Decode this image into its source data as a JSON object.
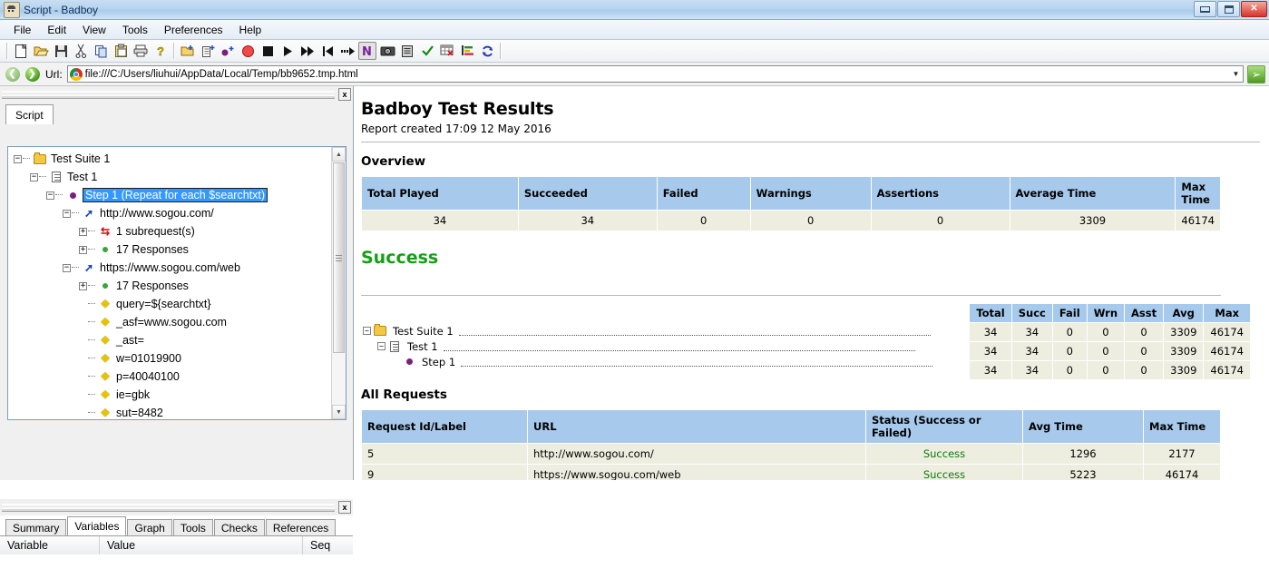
{
  "window": {
    "title": "Script - Badboy",
    "icon": "badboy-app-icon",
    "buttons": {
      "minimize": "minimize",
      "maximize": "maximize",
      "close": "close"
    }
  },
  "menu": {
    "items": [
      "File",
      "Edit",
      "View",
      "Tools",
      "Preferences",
      "Help"
    ]
  },
  "toolbar": {
    "items": [
      {
        "name": "new-icon",
        "glyph": "new"
      },
      {
        "name": "open-folder-icon",
        "glyph": "open"
      },
      {
        "name": "save-icon",
        "glyph": "save"
      },
      {
        "name": "cut-icon",
        "glyph": "cut"
      },
      {
        "name": "copy-icon",
        "glyph": "copy"
      },
      {
        "name": "paste-icon",
        "glyph": "paste"
      },
      {
        "name": "print-icon",
        "glyph": "print"
      },
      {
        "name": "help-icon",
        "glyph": "help"
      },
      {
        "name": "new-suite-icon",
        "glyph": "newsuite"
      },
      {
        "name": "new-test-icon",
        "glyph": "newtest"
      },
      {
        "name": "new-step-icon",
        "glyph": "newstep"
      },
      {
        "name": "record-icon",
        "glyph": "record"
      },
      {
        "name": "stop-icon",
        "glyph": "stop"
      },
      {
        "name": "play-icon",
        "glyph": "play"
      },
      {
        "name": "play-fast-icon",
        "glyph": "playfast"
      },
      {
        "name": "rewind-icon",
        "glyph": "rewind"
      },
      {
        "name": "step-icon",
        "glyph": "stepinto"
      },
      {
        "name": "navigator-icon",
        "glyph": "navigator"
      },
      {
        "name": "screenshot-icon",
        "glyph": "camera"
      },
      {
        "name": "report-icon",
        "glyph": "report"
      },
      {
        "name": "check-icon",
        "glyph": "check"
      },
      {
        "name": "grid-clear-icon",
        "glyph": "gridx"
      },
      {
        "name": "summary-icon",
        "glyph": "summary"
      },
      {
        "name": "refresh-icon",
        "glyph": "refresh"
      }
    ]
  },
  "urlbar": {
    "back_label": "back",
    "forward_label": "forward",
    "label": "Url:",
    "value": "file:///C:/Users/liuhui/AppData/Local/Temp/bb9652.tmp.html",
    "go_label": "go"
  },
  "left_panel": {
    "close_label": "x",
    "tab": "Script",
    "tree": [
      {
        "indent": 0,
        "toggle": "-",
        "icon": "folder-icon",
        "label": "Test Suite 1",
        "selected": false
      },
      {
        "indent": 1,
        "toggle": "-",
        "icon": "test-doc-icon",
        "label": "Test 1",
        "selected": false
      },
      {
        "indent": 2,
        "toggle": "-",
        "icon": "step-bullet-icon",
        "label": "Step 1 (Repeat for each $searchtxt)",
        "selected": true
      },
      {
        "indent": 3,
        "toggle": "-",
        "icon": "request-arrow-icon",
        "label": "http://www.sogou.com/",
        "selected": false
      },
      {
        "indent": 4,
        "toggle": "+",
        "icon": "subrequest-icon",
        "label": "1 subrequest(s)",
        "selected": false
      },
      {
        "indent": 4,
        "toggle": "+",
        "icon": "response-dot-icon",
        "label": "17 Responses",
        "selected": false
      },
      {
        "indent": 3,
        "toggle": "-",
        "icon": "request-arrow-icon",
        "label": "https://www.sogou.com/web",
        "selected": false
      },
      {
        "indent": 4,
        "toggle": "+",
        "icon": "response-dot-icon",
        "label": "17 Responses",
        "selected": false
      },
      {
        "indent": 4,
        "toggle": "",
        "icon": "parameter-key-icon",
        "label": "query=${searchtxt}",
        "selected": false
      },
      {
        "indent": 4,
        "toggle": "",
        "icon": "parameter-key-icon",
        "label": "_asf=www.sogou.com",
        "selected": false
      },
      {
        "indent": 4,
        "toggle": "",
        "icon": "parameter-key-icon",
        "label": "_ast=",
        "selected": false
      },
      {
        "indent": 4,
        "toggle": "",
        "icon": "parameter-key-icon",
        "label": "w=01019900",
        "selected": false
      },
      {
        "indent": 4,
        "toggle": "",
        "icon": "parameter-key-icon",
        "label": "p=40040100",
        "selected": false
      },
      {
        "indent": 4,
        "toggle": "",
        "icon": "parameter-key-icon",
        "label": "ie=gbk",
        "selected": false
      },
      {
        "indent": 4,
        "toggle": "",
        "icon": "parameter-key-icon",
        "label": "sut=8482",
        "selected": false
      }
    ]
  },
  "bottom_panel": {
    "close_label": "x",
    "tabs": [
      "Summary",
      "Variables",
      "Graph",
      "Tools",
      "Checks",
      "References"
    ],
    "active_tab": "Variables",
    "columns": [
      "Variable",
      "Value",
      "Seq"
    ]
  },
  "report": {
    "title": "Badboy Test Results",
    "created": "Report created 17:09 12 May 2016",
    "overview": {
      "heading": "Overview",
      "columns": [
        "Total Played",
        "Succeeded",
        "Failed",
        "Warnings",
        "Assertions",
        "Average Time",
        "Max Time"
      ],
      "row": [
        "34",
        "34",
        "0",
        "0",
        "0",
        "3309",
        "46174"
      ]
    },
    "success": {
      "heading": "Success",
      "columns": [
        "Total",
        "Succ",
        "Fail",
        "Wrn",
        "Asst",
        "Avg",
        "Max"
      ],
      "rows": [
        {
          "indent": 0,
          "toggle": "-",
          "icon": "folder-icon",
          "label": "Test Suite 1",
          "values": [
            "34",
            "34",
            "0",
            "0",
            "0",
            "3309",
            "46174"
          ]
        },
        {
          "indent": 1,
          "toggle": "-",
          "icon": "test-doc-icon",
          "label": "Test 1",
          "values": [
            "34",
            "34",
            "0",
            "0",
            "0",
            "3309",
            "46174"
          ]
        },
        {
          "indent": 2,
          "toggle": "",
          "icon": "step-bullet-icon",
          "label": "Step 1",
          "values": [
            "34",
            "34",
            "0",
            "0",
            "0",
            "3309",
            "46174"
          ]
        }
      ]
    },
    "all_requests": {
      "heading": "All Requests",
      "columns": [
        "Request Id/Label",
        "URL",
        "Status (Success or Failed)",
        "Avg Time",
        "Max Time"
      ],
      "rows": [
        [
          "5",
          "http://www.sogou.com/",
          "Success",
          "1296",
          "2177"
        ],
        [
          "9",
          "https://www.sogou.com/web",
          "Success",
          "5223",
          "46174"
        ]
      ]
    }
  },
  "colors": {
    "table_header": "#a6c9ec",
    "table_cell": "#edeee0",
    "success_green": "#13a113",
    "selection_blue": "#3399ff"
  }
}
